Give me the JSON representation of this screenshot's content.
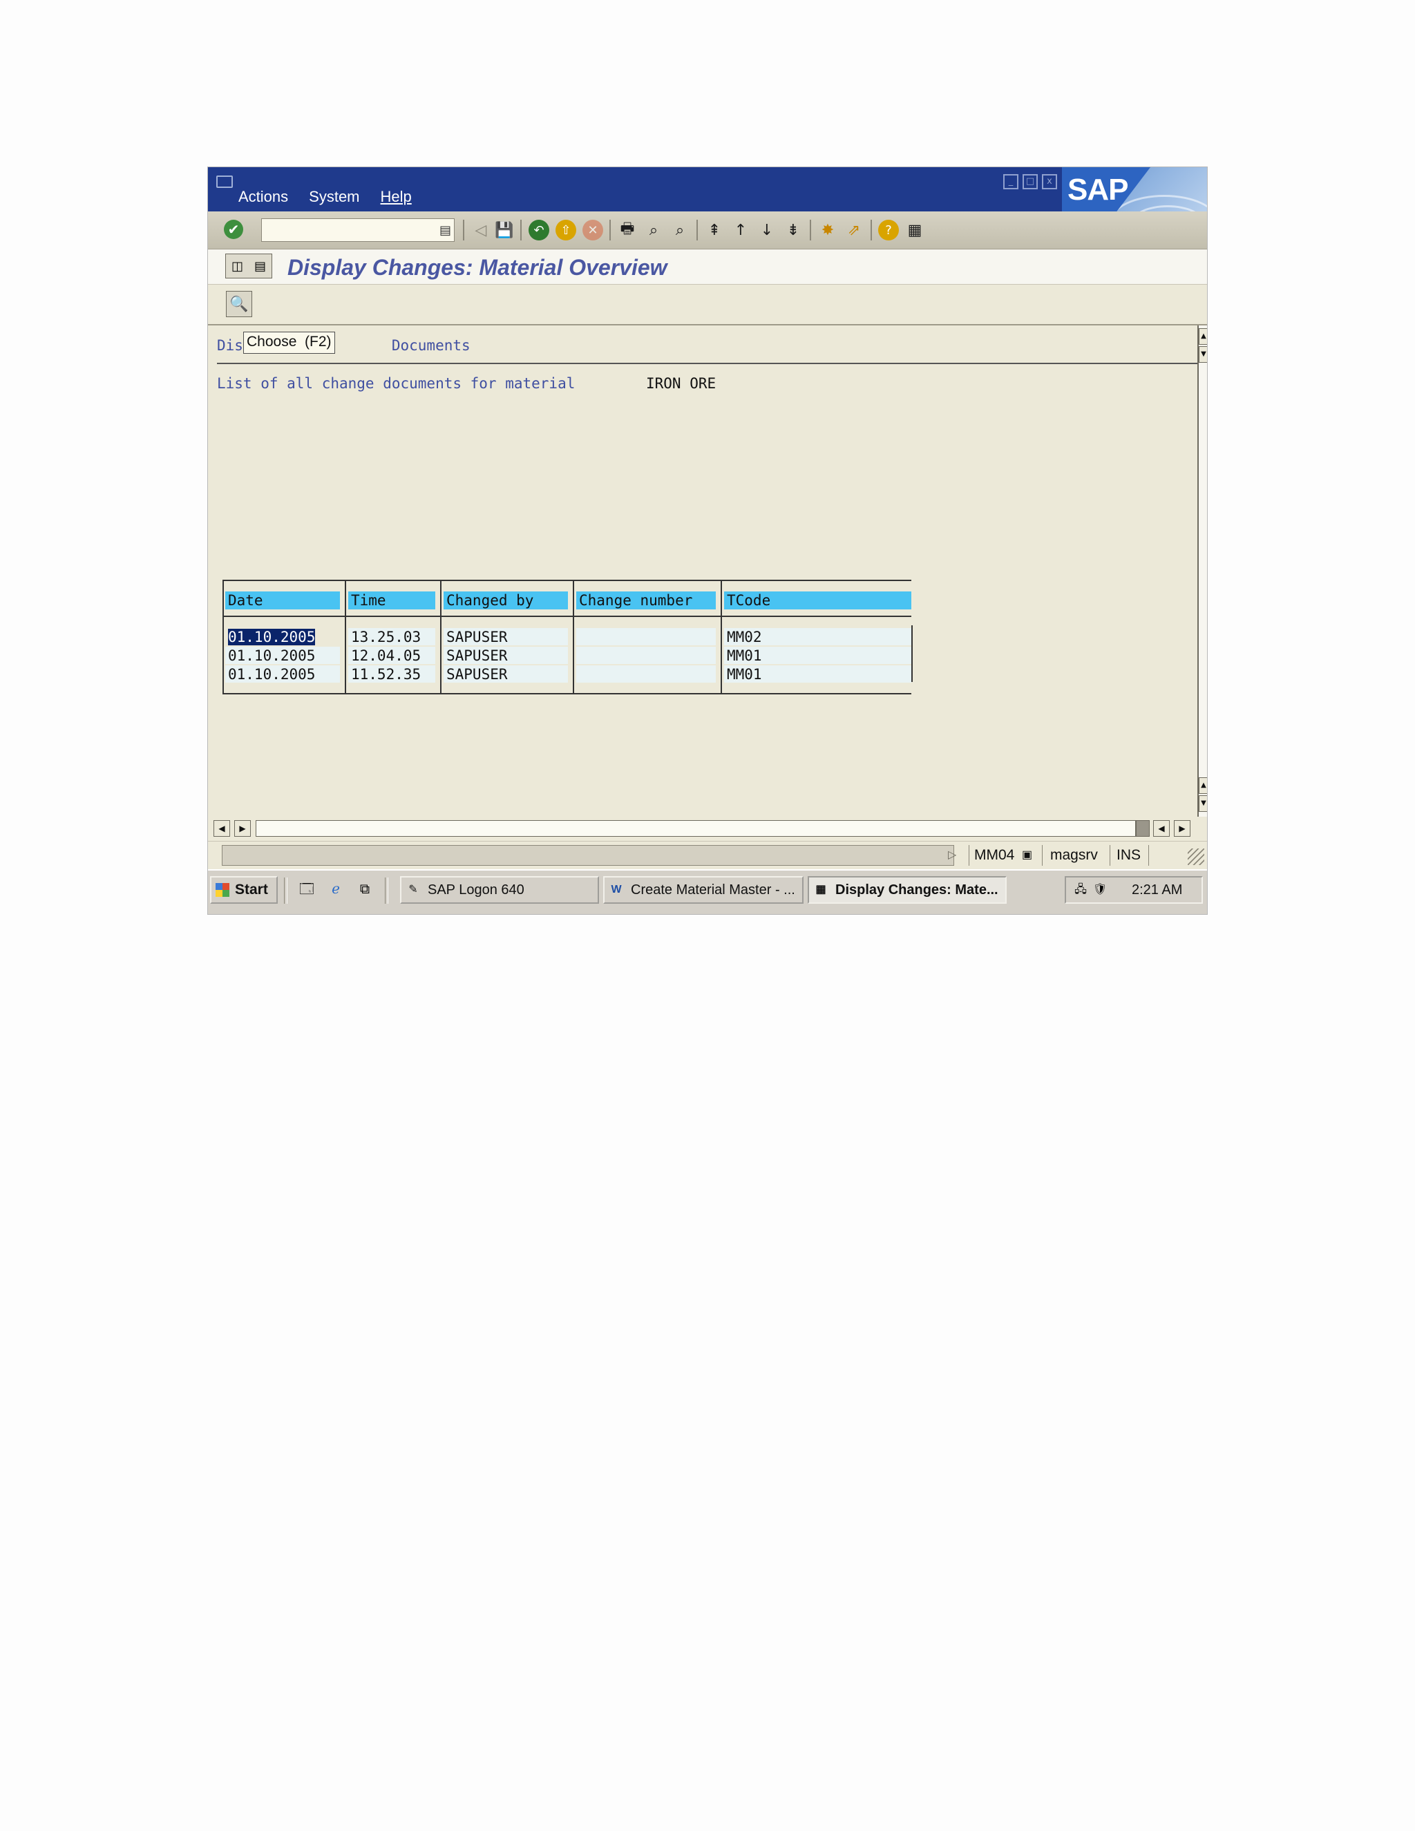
{
  "menu": {
    "items": [
      "Actions",
      "System",
      "Help"
    ]
  },
  "window_buttons": [
    "_",
    "□",
    "x"
  ],
  "brand": {
    "logo_text": "SAP"
  },
  "title": "Display Changes: Material Overview",
  "tooltip": "Choose  (F2)",
  "heading": "Dis                 Documents",
  "list_label": "List of all change documents for material",
  "material": "IRON ORE",
  "table": {
    "columns": [
      "Date",
      "Time",
      "Changed by",
      "Change number",
      "TCode"
    ],
    "rows": [
      [
        "01.10.2005",
        "13.25.03",
        "SAPUSER",
        "",
        "MM02"
      ],
      [
        "01.10.2005",
        "12.04.05",
        "SAPUSER",
        "",
        "MM01"
      ],
      [
        "01.10.2005",
        "11.52.35",
        "SAPUSER",
        "",
        "MM01"
      ]
    ]
  },
  "status": {
    "transaction": "MM04",
    "server": "magsrv",
    "mode": "INS"
  },
  "taskbar": {
    "start_label": "Start",
    "tasks": [
      {
        "label": "SAP Logon 640",
        "icon": "sap-logon-icon"
      },
      {
        "label": "Create Material Master - ...",
        "icon": "word-doc-icon"
      },
      {
        "label": "Display Changes: Mate...",
        "icon": "sap-window-icon"
      }
    ],
    "clock": "2:21 AM"
  },
  "colors": {
    "titlebar": "#1f3a8c",
    "column_header": "#49c3f2",
    "selection": "#0a246a",
    "title_text": "#4a57a2"
  }
}
